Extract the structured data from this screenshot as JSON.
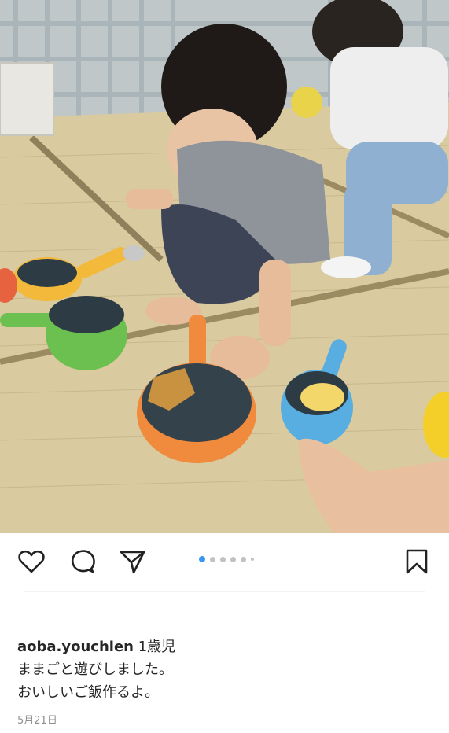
{
  "post": {
    "photo_alt": "",
    "carousel": {
      "count": 6,
      "active_index": 0
    },
    "icons": {
      "like": "heart-icon",
      "comment": "comment-icon",
      "share": "share-icon",
      "save": "bookmark-icon"
    },
    "caption": {
      "username": "aoba.youchien",
      "line1": "1歳児",
      "line2": "ままごと遊びしました。",
      "line3": "おいしいご飯作るよ。"
    },
    "date": "5月21日"
  }
}
